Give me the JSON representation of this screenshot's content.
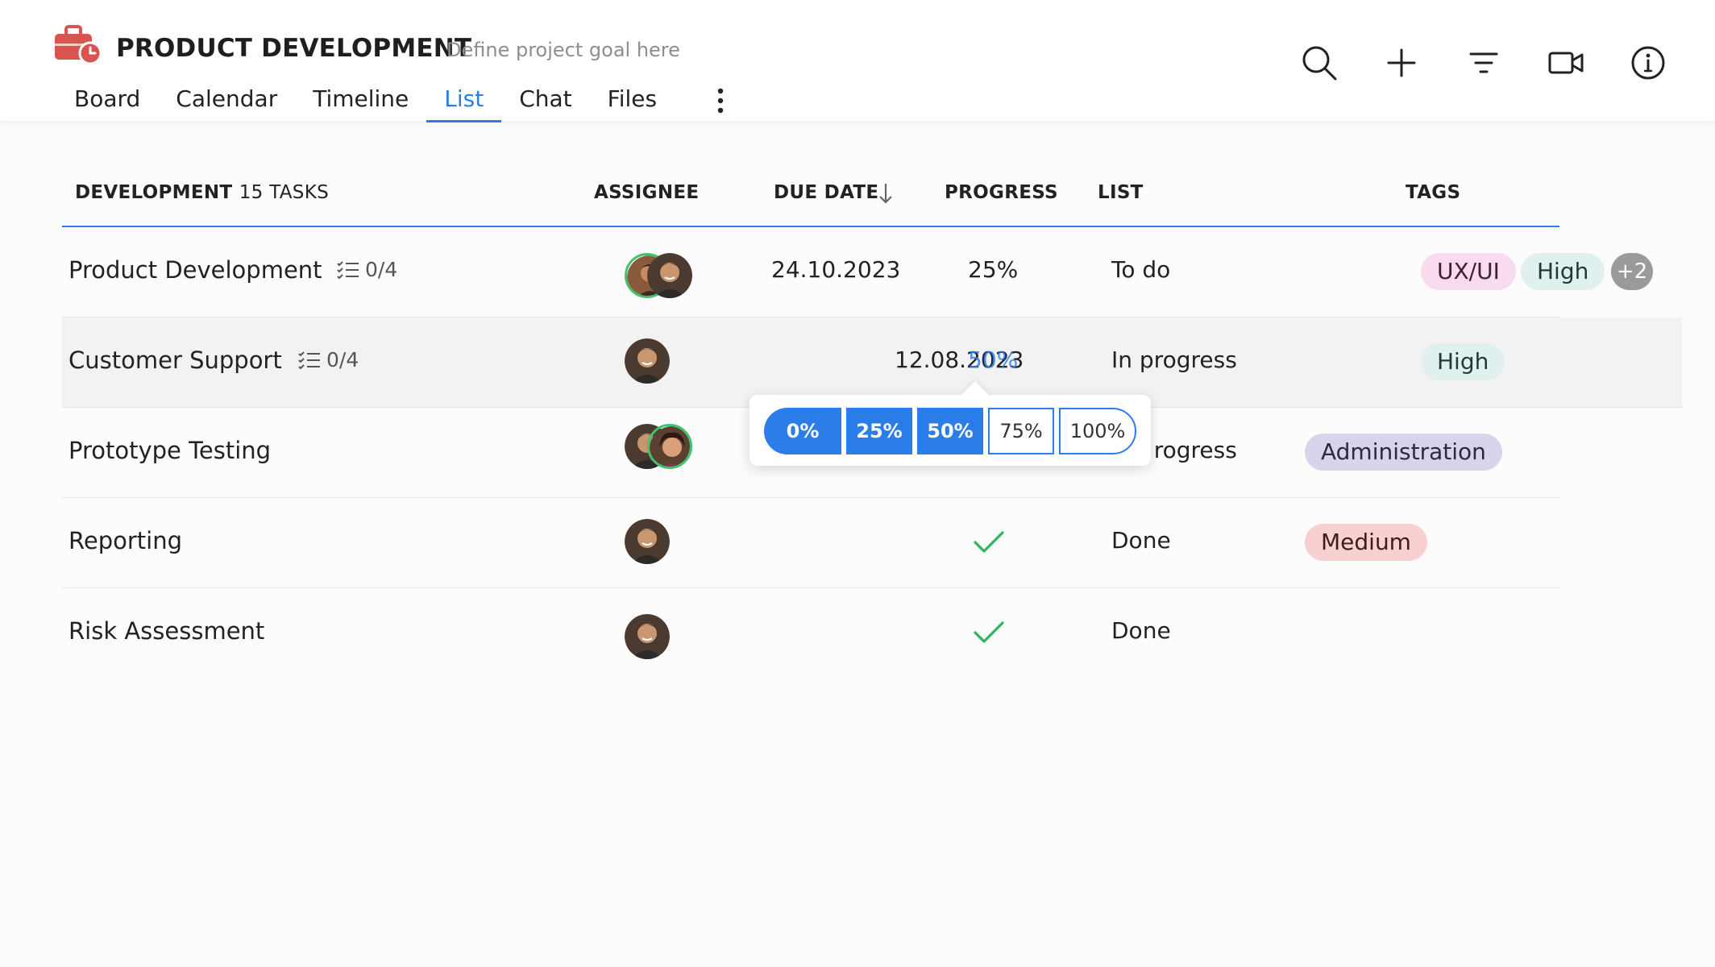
{
  "header": {
    "project_title": "PRODUCT DEVELOPMENT",
    "project_goal": "Define project goal here",
    "tabs": [
      {
        "label": "Board"
      },
      {
        "label": "Calendar"
      },
      {
        "label": "Timeline"
      },
      {
        "label": "List"
      },
      {
        "label": "Chat"
      },
      {
        "label": "Files"
      }
    ],
    "active_tab": "List",
    "icons": [
      "search-icon",
      "add-icon",
      "filter-icon",
      "video-icon",
      "info-icon"
    ]
  },
  "table": {
    "group_name": "DEVELOPMENT",
    "group_count": "15 TASKS",
    "columns": {
      "assignee": "ASSIGNEE",
      "due_date": "DUE DATE",
      "progress": "PROGRESS",
      "list": "LIST",
      "tags": "TAGS"
    },
    "rows": [
      {
        "name": "Product Development",
        "subtasks": "0/4",
        "due": "24.10.2023",
        "progress": "25%",
        "list": "To do",
        "tags": [
          "UX/UI",
          "High"
        ],
        "more_tags": "+2"
      },
      {
        "name": "Customer Support",
        "subtasks": "0/4",
        "due": "12.08.2023",
        "progress": "50%",
        "list": "In progress",
        "tags": [
          "High"
        ]
      },
      {
        "name": "Prototype Testing",
        "due": "",
        "progress": "",
        "list": "In progress",
        "list_visible": "rogress",
        "tags": [
          "Administration"
        ]
      },
      {
        "name": "Reporting",
        "due": "",
        "progress": "done",
        "list": "Done",
        "tags": [
          "Medium"
        ]
      },
      {
        "name": "Risk Assessment",
        "due": "",
        "progress": "done",
        "list": "Done",
        "tags": []
      }
    ]
  },
  "progress_popup": {
    "options": [
      "0%",
      "25%",
      "50%",
      "75%",
      "100%"
    ],
    "selected_up_to": "50%"
  },
  "colors": {
    "accent": "#2b7de9",
    "logo": "#d9534f",
    "check": "#2fb45c"
  }
}
